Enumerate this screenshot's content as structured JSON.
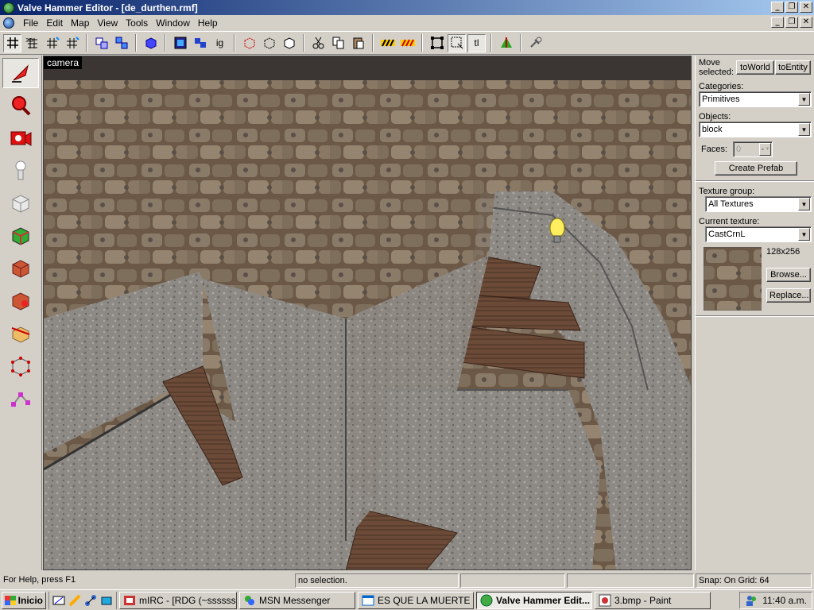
{
  "window": {
    "title": "Valve Hammer Editor - [de_durthen.rmf]",
    "caption_buttons": [
      "_",
      "❐",
      "✕"
    ]
  },
  "menu": [
    "File",
    "Edit",
    "Map",
    "View",
    "Tools",
    "Window",
    "Help"
  ],
  "toolbar": {
    "icons": [
      "grid-icon",
      "3d-grid-icon",
      "smaller-grid-icon",
      "larger-grid-icon",
      "carve-icon",
      "group-icon",
      "ungroup-icon",
      "hide-icon",
      "show-icon",
      "ignore-group-icon",
      "cut-icon",
      "copy-icon",
      "paste-icon",
      "texture-lock-icon",
      "texture-apply-icon",
      "resize-handles-icon",
      "select-icon",
      "texture-toggle-icon",
      "run-map-icon",
      "options-icon"
    ],
    "ignore_label": "ig",
    "tl_label": "tl"
  },
  "tools": [
    "selection-tool-icon",
    "magnify-tool-icon",
    "camera-tool-icon",
    "entity-tool-icon",
    "block-tool-icon",
    "texture-application-icon",
    "apply-texture-icon",
    "decal-tool-icon",
    "clipping-tool-icon",
    "vertex-manipulation-icon",
    "path-tool-icon"
  ],
  "viewport": {
    "label": "camera"
  },
  "side_panel": {
    "move_selected_label": "Move selected:",
    "to_world": "toWorld",
    "to_entity": "toEntity",
    "categories_label": "Categories:",
    "categories_value": "Primitives",
    "objects_label": "Objects:",
    "objects_value": "block",
    "faces_label": "Faces:",
    "faces_value": "0",
    "create_prefab": "Create Prefab",
    "texture_group_label": "Texture group:",
    "texture_group_value": "All Textures",
    "current_texture_label": "Current texture:",
    "current_texture_value": "CastCrnL",
    "texture_size": "128x256",
    "browse": "Browse...",
    "replace": "Replace..."
  },
  "status": {
    "help": "For Help, press F1",
    "selection": "no selection.",
    "snap": "Snap: On Grid: 64"
  },
  "taskbar": {
    "start": "Inicio",
    "tasks": [
      "mIRC - [RDG (~sssssss...",
      "MSN Messenger",
      "ES QUE LA MUERTE ...",
      "Valve Hammer Edit...",
      "3.bmp - Paint"
    ],
    "active_task": 3,
    "clock": "11:40 a.m."
  },
  "colors": {
    "titlebar": "#0a246a",
    "face": "#d4d0c8"
  }
}
